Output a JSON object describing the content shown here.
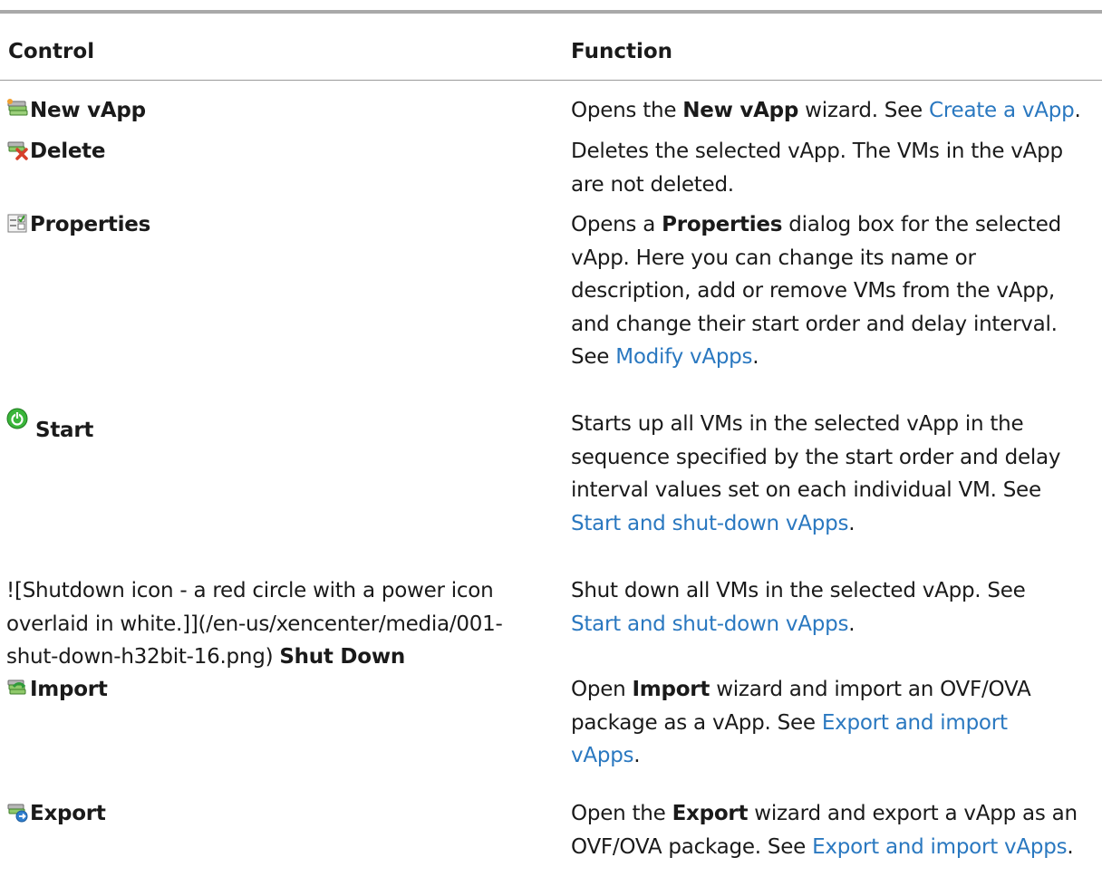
{
  "table": {
    "headers": {
      "control": "Control",
      "function": "Function"
    },
    "rows": [
      {
        "control": "New vApp",
        "icon": "new-vapp-icon",
        "func_pre": "Opens the ",
        "func_bold": "New vApp",
        "func_mid": " wizard. See ",
        "func_link": "Create a vApp",
        "func_end": "."
      },
      {
        "control": "Delete",
        "icon": "delete-vapp-icon",
        "func_line1": "Deletes the selected vApp. The VMs in the vApp",
        "func_line2": "are not deleted."
      },
      {
        "control": "Properties",
        "icon": "properties-icon",
        "func_pre": "Opens a ",
        "func_bold": "Properties",
        "func_line1_rest": " dialog box for the selected",
        "func_line2": "vApp. Here you can change its name or",
        "func_line3": "description, add or remove VMs from the vApp,",
        "func_line4": "and change their start order and delay interval.",
        "func_see": "See ",
        "func_link": "Modify vApps",
        "func_end": "."
      },
      {
        "control": "Start",
        "icon": "start-icon",
        "func_line1": "Starts up all VMs in the selected vApp in the",
        "func_line2": "sequence specified by the start order and delay",
        "func_line3": "interval values set on each individual VM. See",
        "func_link": "Start and shut-down vApps",
        "func_end": "."
      },
      {
        "control_line1": "![Shutdown icon - a red circle with a power icon",
        "control_line2": "overlaid in white.]](/en-us/xencenter/media/001-",
        "control_line3_pre": "shut-down-h32bit-16.png) ",
        "control": "Shut Down",
        "func_line1": "Shut down all VMs in the selected vApp. See",
        "func_link": "Start and shut-down vApps",
        "func_end": "."
      },
      {
        "control": "Import",
        "icon": "import-icon",
        "func_pre": "Open ",
        "func_bold": "Import",
        "func_line1_rest": " wizard and import an OVF/OVA",
        "func_line2_pre": "package as a vApp. See ",
        "func_link_a": "Export and import",
        "func_link_b": "vApps",
        "func_end": "."
      },
      {
        "control": "Export",
        "icon": "export-icon",
        "func_pre": "Open the ",
        "func_bold": "Export",
        "func_line1_rest": " wizard and export a vApp as an",
        "func_line2_pre": "OVF/OVA package. See ",
        "func_link": "Export and import vApps",
        "func_end": "."
      }
    ]
  },
  "colors": {
    "link": "#2a78c0",
    "rule": "#a9a9a9",
    "text": "#1a1a1a"
  }
}
